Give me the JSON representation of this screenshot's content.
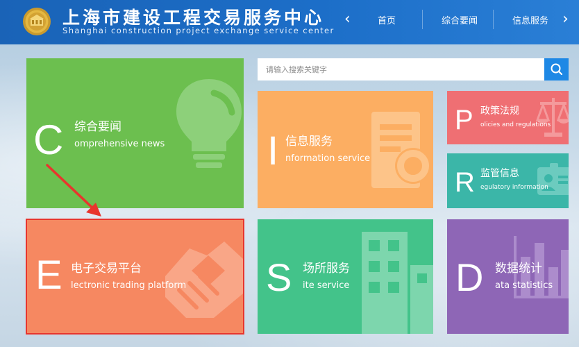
{
  "header": {
    "title_cn": "上海市建设工程交易服务中心",
    "title_en": "Shanghai construction project exchange service center",
    "nav_prev": "‹",
    "nav_next": "›",
    "nav_items": [
      "首页",
      "综合要闻",
      "信息服务"
    ]
  },
  "search": {
    "placeholder": "请输入搜索关键字"
  },
  "tiles": {
    "news": {
      "letter": "C",
      "cn": "综合要闻",
      "en": "omprehensive news",
      "color": "#6cbf4f"
    },
    "info": {
      "letter": "I",
      "cn": "信息服务",
      "en": "nformation service",
      "color": "#fcae62"
    },
    "policy": {
      "letter": "P",
      "cn": "政策法规",
      "en": "olicies and regulations",
      "color": "#ef6f73"
    },
    "regulatory": {
      "letter": "R",
      "cn": "监管信息",
      "en": "egulatory information",
      "color": "#3bb6a8"
    },
    "trading": {
      "letter": "E",
      "cn": "电子交易平台",
      "en": "lectronic trading platform",
      "color": "#f68861"
    },
    "site": {
      "letter": "S",
      "cn": "场所服务",
      "en": "ite service",
      "color": "#43c38a"
    },
    "stats": {
      "letter": "D",
      "cn": "数据统计",
      "en": "ata statistics",
      "color": "#8e66b6"
    }
  },
  "colors": {
    "header": "#1c6ec8",
    "search_button": "#1e88e5",
    "arrow": "#e8352d"
  }
}
